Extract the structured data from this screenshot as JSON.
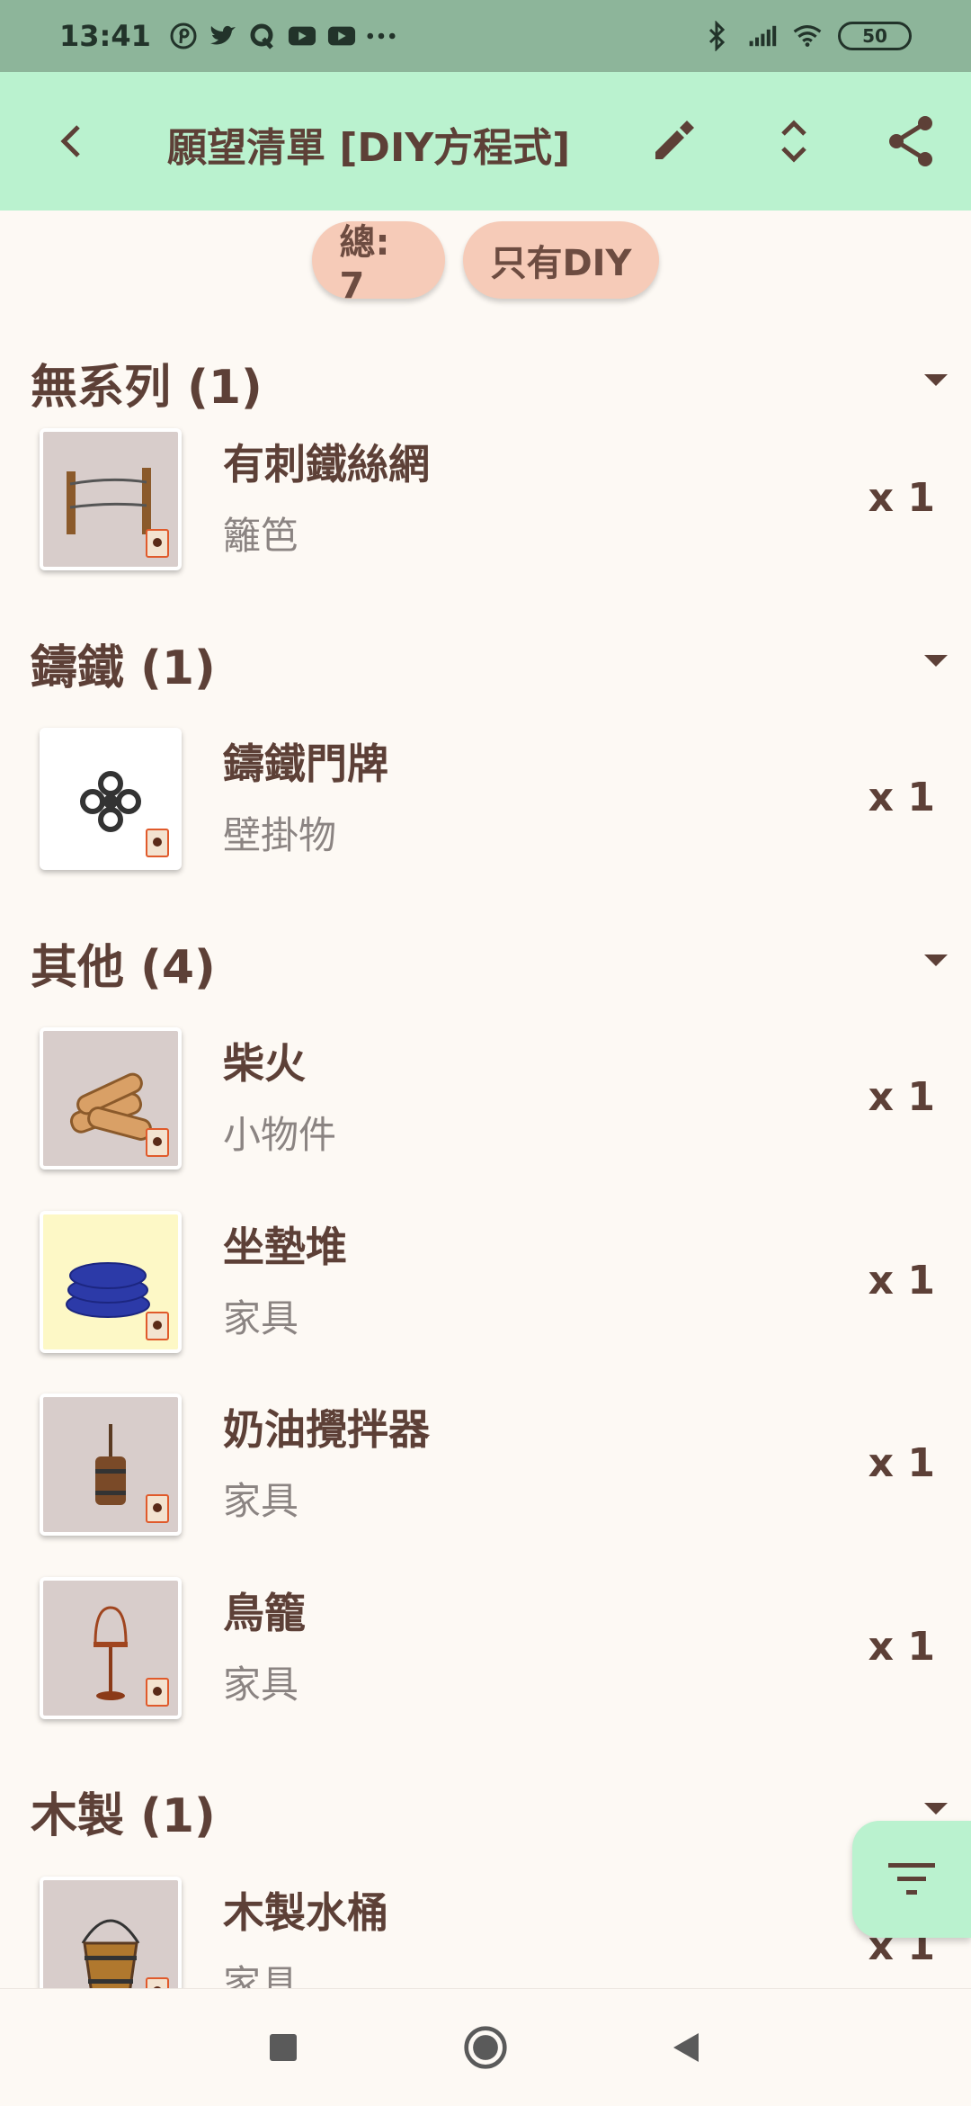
{
  "status_bar": {
    "time": "13:41",
    "notification_icons": [
      "pinterest-icon",
      "twitter-icon",
      "quora-icon",
      "youtube-icon",
      "youtube-icon",
      "more-icon"
    ],
    "battery": "50"
  },
  "app_bar": {
    "title": "願望清單 [DIY方程式]",
    "back_icon": "arrow-back-icon",
    "actions": [
      "edit-icon",
      "expand-icon",
      "share-icon"
    ]
  },
  "chips": {
    "total_label": "總: 7",
    "filter_label": "只有DIY"
  },
  "sections": [
    {
      "title": "無系列 (1)",
      "items": [
        {
          "name": "有刺鐵絲網",
          "category": "籬笆",
          "quantity": "x 1",
          "image": "barbed-wire-fence-icon"
        }
      ]
    },
    {
      "title": "鑄鐵 (1)",
      "items": [
        {
          "name": "鑄鐵門牌",
          "category": "壁掛物",
          "quantity": "x 1",
          "image": "iron-sign-icon"
        }
      ]
    },
    {
      "title": "其他 (4)",
      "items": [
        {
          "name": "柴火",
          "category": "小物件",
          "quantity": "x 1",
          "image": "firewood-icon"
        },
        {
          "name": "坐墊堆",
          "category": "家具",
          "quantity": "x 1",
          "image": "cushion-stack-icon"
        },
        {
          "name": "奶油攪拌器",
          "category": "家具",
          "quantity": "x 1",
          "image": "butter-churn-icon"
        },
        {
          "name": "鳥籠",
          "category": "家具",
          "quantity": "x 1",
          "image": "birdcage-icon"
        }
      ]
    },
    {
      "title": "木製 (1)",
      "items": [
        {
          "name": "木製水桶",
          "category": "家具",
          "quantity": "x 1",
          "image": "wooden-bucket-icon"
        }
      ]
    }
  ],
  "fab_icon": "filter-icon",
  "nav_bar": [
    "recents-icon",
    "home-icon",
    "back-icon"
  ],
  "colors": {
    "status_bar": "#8db59a",
    "app_bar": "#baf2cf",
    "background": "#fdf9f4",
    "chip": "#f6cbb8",
    "text_primary": "#5d4037",
    "text_secondary": "#8b8482"
  }
}
